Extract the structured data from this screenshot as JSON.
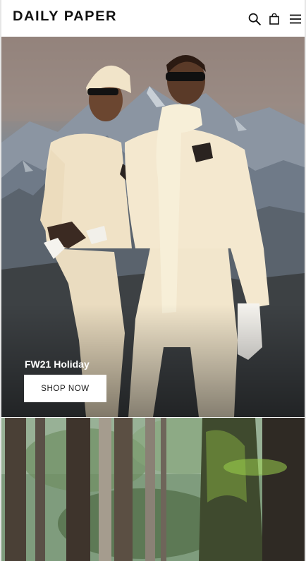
{
  "header": {
    "logo_text": "DAILY PAPER",
    "icons": [
      "search-icon",
      "bag-icon",
      "menu-icon"
    ]
  },
  "hero": {
    "title": "FW21 Holiday",
    "cta_label": "SHOP NOW"
  },
  "colors": {
    "header_bg": "#ffffff",
    "logo": "#111111",
    "cta_bg": "#ffffff",
    "cta_text": "#1a1a1a",
    "hero_text": "#ffffff"
  }
}
